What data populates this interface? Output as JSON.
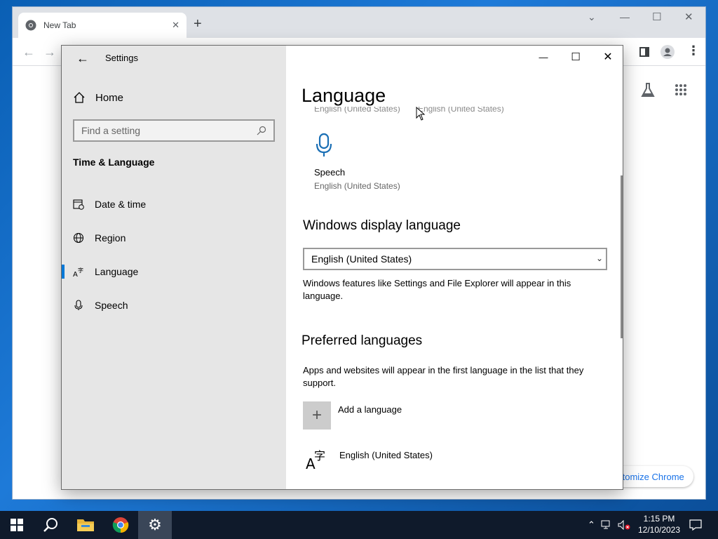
{
  "chrome": {
    "tab_title": "New Tab",
    "tab_close": "✕",
    "new_tab": "+",
    "customize_label": "ıtomize Chrome"
  },
  "settings": {
    "window_title": "Settings",
    "home_label": "Home",
    "search_placeholder": "Find a setting",
    "group_title": "Time & Language",
    "nav": [
      {
        "label": "Date & time",
        "icon": "calendar-clock-icon"
      },
      {
        "label": "Region",
        "icon": "globe-icon"
      },
      {
        "label": "Language",
        "icon": "language-icon"
      },
      {
        "label": "Speech",
        "icon": "microphone-icon"
      }
    ],
    "active_nav": "Language",
    "page_title": "Language",
    "faded_left": "English (United States)",
    "faded_right": "English (United States)",
    "speech_tile": {
      "title": "Speech",
      "subtitle": "English (United States)"
    },
    "display_language": {
      "heading": "Windows display language",
      "selected": "English (United States)",
      "description": "Windows features like Settings and File Explorer will appear in this language."
    },
    "preferred": {
      "heading": "Preferred languages",
      "description": "Apps and websites will appear in the first language in the list that they support.",
      "add_label": "Add a language",
      "languages": [
        "English (United States)"
      ]
    }
  },
  "taskbar": {
    "time": "1:15 PM",
    "date": "12/10/2023"
  },
  "colors": {
    "accent": "#0078d7",
    "sidebar_bg": "#e6e6e6",
    "taskbar_bg": "#0f1a2b"
  }
}
